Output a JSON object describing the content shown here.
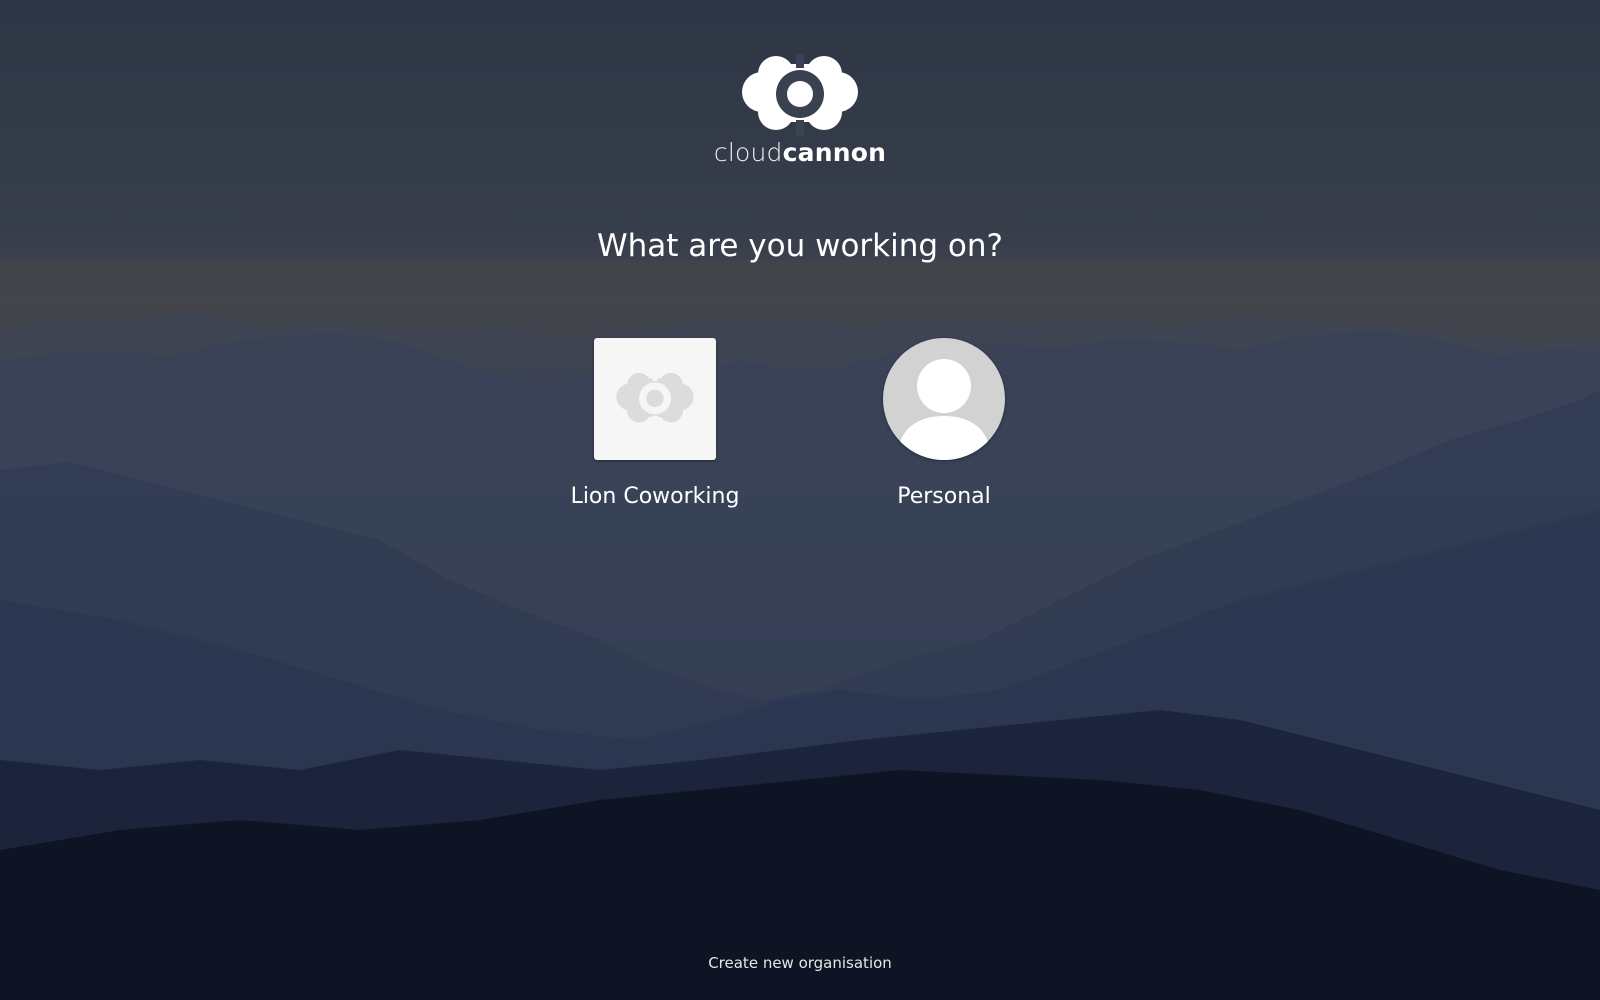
{
  "brand": {
    "name_light": "cloud",
    "name_bold": "cannon",
    "logo_icon": "cloudcannon-logo-icon"
  },
  "prompt": {
    "heading": "What are you working on?"
  },
  "workspaces": [
    {
      "label": "Lion Coworking",
      "icon": "organisation-logo-icon"
    },
    {
      "label": "Personal",
      "icon": "user-avatar-icon"
    }
  ],
  "footer": {
    "create_link": "Create new organisation"
  },
  "colors": {
    "text": "#ffffff",
    "avatar_bg": "#d2d2d2",
    "org_tile_bg": "#f6f6f6",
    "org_logo": "#dcdcdc"
  }
}
